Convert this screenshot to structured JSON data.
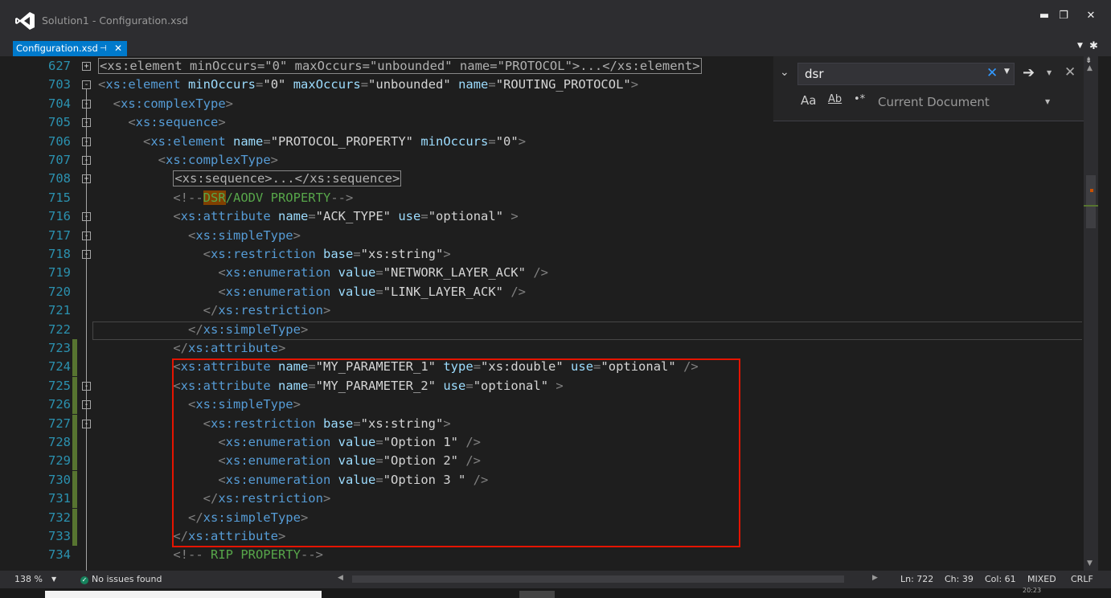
{
  "window": {
    "title": "Solution1 - Configuration.xsd",
    "minimize_glyph": "▬",
    "restore_glyph": "❐",
    "close_glyph": "✕"
  },
  "tab": {
    "label": "Configuration.xsd",
    "pin_glyph": "⊣",
    "close_glyph": "✕",
    "active_color": "#007acc"
  },
  "tab_row": {
    "dropdown_glyph": "▼",
    "gear_glyph": "✱"
  },
  "find": {
    "query": "dsr",
    "clear_glyph": "✕",
    "history_glyph": "▼",
    "next_glyph": "➔",
    "close_glyph": "✕",
    "match_case_label": "Aa",
    "whole_word_label": "Ab",
    "regex_label": "•*",
    "scope": "Current Document",
    "toggle_glyph": "⌄"
  },
  "lines": [
    {
      "n": "627",
      "fold": "+",
      "parts": [
        [
          "collapsed",
          "<xs:element minOccurs=\"0\" maxOccurs=\"unbounded\" name=\"PROTOCOL\">...</xs:element>"
        ]
      ]
    },
    {
      "n": "703",
      "fold": "-",
      "parts": [
        [
          "p",
          "<"
        ],
        [
          "e",
          "xs:element"
        ],
        [
          "a",
          " minOccurs"
        ],
        [
          "p",
          "="
        ],
        [
          "q",
          "\""
        ],
        [
          "v",
          "0"
        ],
        [
          "q",
          "\""
        ],
        [
          "a",
          " maxOccurs"
        ],
        [
          "p",
          "="
        ],
        [
          "q",
          "\""
        ],
        [
          "v",
          "unbounded"
        ],
        [
          "q",
          "\""
        ],
        [
          "a",
          " name"
        ],
        [
          "p",
          "="
        ],
        [
          "q",
          "\""
        ],
        [
          "v",
          "ROUTING_PROTOCOL"
        ],
        [
          "q",
          "\""
        ],
        [
          "p",
          ">"
        ]
      ]
    },
    {
      "n": "704",
      "fold": "-",
      "parts": [
        [
          "q",
          "  "
        ],
        [
          "p",
          "<"
        ],
        [
          "e",
          "xs:complexType"
        ],
        [
          "p",
          ">"
        ]
      ]
    },
    {
      "n": "705",
      "fold": "-",
      "parts": [
        [
          "q",
          "    "
        ],
        [
          "p",
          "<"
        ],
        [
          "e",
          "xs:sequence"
        ],
        [
          "p",
          ">"
        ]
      ]
    },
    {
      "n": "706",
      "fold": "-",
      "parts": [
        [
          "q",
          "      "
        ],
        [
          "p",
          "<"
        ],
        [
          "e",
          "xs:element"
        ],
        [
          "a",
          " name"
        ],
        [
          "p",
          "="
        ],
        [
          "q",
          "\""
        ],
        [
          "v",
          "PROTOCOL_PROPERTY"
        ],
        [
          "q",
          "\""
        ],
        [
          "a",
          " minOccurs"
        ],
        [
          "p",
          "="
        ],
        [
          "q",
          "\""
        ],
        [
          "v",
          "0"
        ],
        [
          "q",
          "\""
        ],
        [
          "p",
          ">"
        ]
      ]
    },
    {
      "n": "707",
      "fold": "-",
      "parts": [
        [
          "q",
          "        "
        ],
        [
          "p",
          "<"
        ],
        [
          "e",
          "xs:complexType"
        ],
        [
          "p",
          ">"
        ]
      ]
    },
    {
      "n": "708",
      "fold": "+",
      "parts": [
        [
          "q",
          "          "
        ],
        [
          "collapsed",
          "<xs:sequence>...</xs:sequence>"
        ]
      ]
    },
    {
      "n": "715",
      "fold": "",
      "parts": [
        [
          "q",
          "          "
        ],
        [
          "p",
          "<!--"
        ],
        [
          "h",
          "DSR"
        ],
        [
          "c",
          "/AODV PROPERTY"
        ],
        [
          "p",
          "-->"
        ]
      ]
    },
    {
      "n": "716",
      "fold": "-",
      "parts": [
        [
          "q",
          "          "
        ],
        [
          "p",
          "<"
        ],
        [
          "e",
          "xs:attribute"
        ],
        [
          "a",
          " name"
        ],
        [
          "p",
          "="
        ],
        [
          "q",
          "\""
        ],
        [
          "v",
          "ACK_TYPE"
        ],
        [
          "q",
          "\""
        ],
        [
          "a",
          " use"
        ],
        [
          "p",
          "="
        ],
        [
          "q",
          "\""
        ],
        [
          "v",
          "optional"
        ],
        [
          "q",
          "\""
        ],
        [
          "p",
          " >"
        ]
      ]
    },
    {
      "n": "717",
      "fold": "-",
      "parts": [
        [
          "q",
          "            "
        ],
        [
          "p",
          "<"
        ],
        [
          "e",
          "xs:simpleType"
        ],
        [
          "p",
          ">"
        ]
      ]
    },
    {
      "n": "718",
      "fold": "-",
      "parts": [
        [
          "q",
          "              "
        ],
        [
          "p",
          "<"
        ],
        [
          "e",
          "xs:restriction"
        ],
        [
          "a",
          " base"
        ],
        [
          "p",
          "="
        ],
        [
          "q",
          "\""
        ],
        [
          "v",
          "xs:string"
        ],
        [
          "q",
          "\""
        ],
        [
          "p",
          ">"
        ]
      ]
    },
    {
      "n": "719",
      "fold": "",
      "parts": [
        [
          "q",
          "                "
        ],
        [
          "p",
          "<"
        ],
        [
          "e",
          "xs:enumeration"
        ],
        [
          "a",
          " value"
        ],
        [
          "p",
          "="
        ],
        [
          "q",
          "\""
        ],
        [
          "v",
          "NETWORK_LAYER_ACK"
        ],
        [
          "q",
          "\""
        ],
        [
          "p",
          " />"
        ]
      ]
    },
    {
      "n": "720",
      "fold": "",
      "parts": [
        [
          "q",
          "                "
        ],
        [
          "p",
          "<"
        ],
        [
          "e",
          "xs:enumeration"
        ],
        [
          "a",
          " value"
        ],
        [
          "p",
          "="
        ],
        [
          "q",
          "\""
        ],
        [
          "v",
          "LINK_LAYER_ACK"
        ],
        [
          "q",
          "\""
        ],
        [
          "p",
          " />"
        ]
      ]
    },
    {
      "n": "721",
      "fold": "",
      "parts": [
        [
          "q",
          "              "
        ],
        [
          "p",
          "</"
        ],
        [
          "e",
          "xs:restriction"
        ],
        [
          "p",
          ">"
        ]
      ]
    },
    {
      "n": "722",
      "fold": "",
      "parts": [
        [
          "q",
          "            "
        ],
        [
          "p",
          "</"
        ],
        [
          "e",
          "xs:simpleType"
        ],
        [
          "p",
          ">"
        ]
      ]
    },
    {
      "n": "723",
      "fold": "",
      "chg": true,
      "parts": [
        [
          "q",
          "          "
        ],
        [
          "p",
          "</"
        ],
        [
          "e",
          "xs:attribute"
        ],
        [
          "p",
          ">"
        ]
      ]
    },
    {
      "n": "724",
      "fold": "",
      "chg": true,
      "parts": [
        [
          "q",
          "          "
        ],
        [
          "p",
          "<"
        ],
        [
          "e",
          "xs:attribute"
        ],
        [
          "a",
          " name"
        ],
        [
          "p",
          "="
        ],
        [
          "q",
          "\""
        ],
        [
          "v",
          "MY_PARAMETER_1"
        ],
        [
          "q",
          "\""
        ],
        [
          "a",
          " type"
        ],
        [
          "p",
          "="
        ],
        [
          "q",
          "\""
        ],
        [
          "v",
          "xs:double"
        ],
        [
          "q",
          "\""
        ],
        [
          "a",
          " use"
        ],
        [
          "p",
          "="
        ],
        [
          "q",
          "\""
        ],
        [
          "v",
          "optional"
        ],
        [
          "q",
          "\""
        ],
        [
          "p",
          " />"
        ]
      ]
    },
    {
      "n": "725",
      "fold": "-",
      "chg": true,
      "parts": [
        [
          "q",
          "          "
        ],
        [
          "p",
          "<"
        ],
        [
          "e",
          "xs:attribute"
        ],
        [
          "a",
          " name"
        ],
        [
          "p",
          "="
        ],
        [
          "q",
          "\""
        ],
        [
          "v",
          "MY_PARAMETER_2"
        ],
        [
          "q",
          "\""
        ],
        [
          "a",
          " use"
        ],
        [
          "p",
          "="
        ],
        [
          "q",
          "\""
        ],
        [
          "v",
          "optional"
        ],
        [
          "q",
          "\""
        ],
        [
          "p",
          " >"
        ]
      ]
    },
    {
      "n": "726",
      "fold": "-",
      "chg": true,
      "parts": [
        [
          "q",
          "            "
        ],
        [
          "p",
          "<"
        ],
        [
          "e",
          "xs:simpleType"
        ],
        [
          "p",
          ">"
        ]
      ]
    },
    {
      "n": "727",
      "fold": "-",
      "chg": true,
      "parts": [
        [
          "q",
          "              "
        ],
        [
          "p",
          "<"
        ],
        [
          "e",
          "xs:restriction"
        ],
        [
          "a",
          " base"
        ],
        [
          "p",
          "="
        ],
        [
          "q",
          "\""
        ],
        [
          "v",
          "xs:string"
        ],
        [
          "q",
          "\""
        ],
        [
          "p",
          ">"
        ]
      ]
    },
    {
      "n": "728",
      "fold": "",
      "chg": true,
      "parts": [
        [
          "q",
          "                "
        ],
        [
          "p",
          "<"
        ],
        [
          "e",
          "xs:enumeration"
        ],
        [
          "a",
          " value"
        ],
        [
          "p",
          "="
        ],
        [
          "q",
          "\""
        ],
        [
          "v",
          "Option 1"
        ],
        [
          "q",
          "\""
        ],
        [
          "p",
          " />"
        ]
      ]
    },
    {
      "n": "729",
      "fold": "",
      "chg": true,
      "parts": [
        [
          "q",
          "                "
        ],
        [
          "p",
          "<"
        ],
        [
          "e",
          "xs:enumeration"
        ],
        [
          "a",
          " value"
        ],
        [
          "p",
          "="
        ],
        [
          "q",
          "\""
        ],
        [
          "v",
          "Option 2"
        ],
        [
          "q",
          "\""
        ],
        [
          "p",
          " />"
        ]
      ]
    },
    {
      "n": "730",
      "fold": "",
      "chg": true,
      "parts": [
        [
          "q",
          "                "
        ],
        [
          "p",
          "<"
        ],
        [
          "e",
          "xs:enumeration"
        ],
        [
          "a",
          " value"
        ],
        [
          "p",
          "="
        ],
        [
          "q",
          "\""
        ],
        [
          "v",
          "Option 3 "
        ],
        [
          "q",
          "\""
        ],
        [
          "p",
          " />"
        ]
      ]
    },
    {
      "n": "731",
      "fold": "",
      "chg": true,
      "parts": [
        [
          "q",
          "              "
        ],
        [
          "p",
          "</"
        ],
        [
          "e",
          "xs:restriction"
        ],
        [
          "p",
          ">"
        ]
      ]
    },
    {
      "n": "732",
      "fold": "",
      "chg": true,
      "parts": [
        [
          "q",
          "            "
        ],
        [
          "p",
          "</"
        ],
        [
          "e",
          "xs:simpleType"
        ],
        [
          "p",
          ">"
        ]
      ]
    },
    {
      "n": "733",
      "fold": "",
      "chg": true,
      "parts": [
        [
          "q",
          "          "
        ],
        [
          "p",
          "</"
        ],
        [
          "e",
          "xs:attribute"
        ],
        [
          "p",
          ">"
        ]
      ]
    },
    {
      "n": "734",
      "fold": "",
      "parts": [
        [
          "q",
          "          "
        ],
        [
          "p",
          "<!--"
        ],
        [
          "c",
          " RIP PROPERTY"
        ],
        [
          "p",
          "-->"
        ]
      ]
    }
  ],
  "status": {
    "zoom": "138 %",
    "zoom_dropdown": "▼",
    "issues": "No issues found",
    "ok_glyph": "✓",
    "ln": "Ln: 722",
    "ch": "Ch: 39",
    "col": "Col: 61",
    "line_endings": "MIXED",
    "crlf": "CRLF"
  },
  "taskbar": {
    "time": "20:23"
  }
}
